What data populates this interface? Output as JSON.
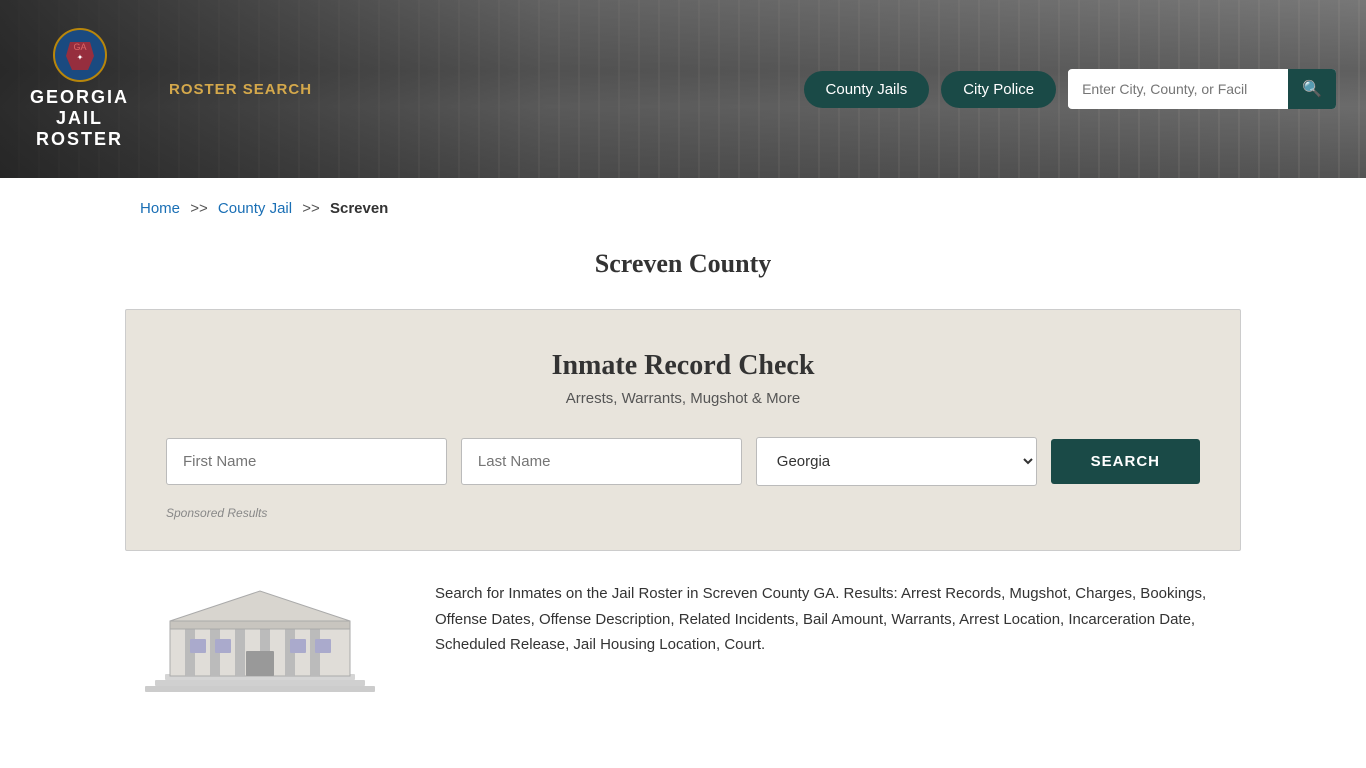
{
  "header": {
    "logo": {
      "line1": "GEORGIA",
      "line2": "JAIL",
      "line3": "ROSTER"
    },
    "nav_link": "ROSTER SEARCH",
    "county_jails_btn": "County Jails",
    "city_police_btn": "City Police",
    "search_placeholder": "Enter City, County, or Facil"
  },
  "breadcrumb": {
    "home": "Home",
    "sep1": ">>",
    "county_jail": "County Jail",
    "sep2": ">>",
    "current": "Screven"
  },
  "page_title": "Screven County",
  "record_check": {
    "title": "Inmate Record Check",
    "subtitle": "Arrests, Warrants, Mugshot & More",
    "first_name_placeholder": "First Name",
    "last_name_placeholder": "Last Name",
    "state_default": "Georgia",
    "search_btn": "SEARCH",
    "sponsored_label": "Sponsored Results"
  },
  "bottom": {
    "description": "Search for Inmates on the Jail Roster in Screven County GA. Results: Arrest Records, Mugshot, Charges, Bookings, Offense Dates, Offense Description, Related Incidents, Bail Amount, Warrants, Arrest Location, Incarceration Date, Scheduled Release, Jail Housing Location, Court."
  }
}
